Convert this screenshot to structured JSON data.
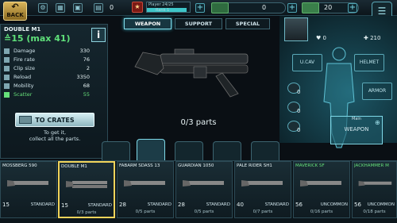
{
  "topbar": {
    "back_label": "BACK",
    "bolts_count": "0",
    "xp_label": "Player 24/25",
    "rank_label": "Rank 1",
    "cash_amount": "0",
    "gold_amount": "20"
  },
  "weapon": {
    "name": "DOUBLE M1",
    "level_text": "15 (max 41)",
    "stats": [
      {
        "label": "Damage",
        "value": "330"
      },
      {
        "label": "Fire rate",
        "value": "76"
      },
      {
        "label": "Clip size",
        "value": "2"
      },
      {
        "label": "Reload",
        "value": "3350"
      },
      {
        "label": "Mobility",
        "value": "68"
      },
      {
        "label": "Scatter",
        "value": "55"
      }
    ],
    "crates_label": "TO CRATES",
    "hint_line1": "To get it,",
    "hint_line2": "collect all the parts.",
    "parts_text": "0/3 parts"
  },
  "tabs": [
    {
      "label": "WEAPON"
    },
    {
      "label": "SUPPORT"
    },
    {
      "label": "SPECIAL"
    }
  ],
  "player": {
    "like_count": "0",
    "score": "210",
    "slots": {
      "ucav": "U.CAV",
      "helmet": "HELMET",
      "armor": "ARMOR"
    },
    "consumables": [
      {
        "count": "0"
      },
      {
        "count": "0"
      },
      {
        "count": "0"
      }
    ],
    "main_label": "Main",
    "main_weapon": "WEAPON"
  },
  "cards": [
    {
      "name": "MOSSBERG 590",
      "level": "15",
      "rarity": "STANDARD",
      "parts": ""
    },
    {
      "name": "DOUBLE M1",
      "level": "15",
      "rarity": "STANDARD",
      "parts": "0/3 parts"
    },
    {
      "name": "FABARM SDASS 13",
      "level": "28",
      "rarity": "STANDARD",
      "parts": "0/5 parts"
    },
    {
      "name": "GUARDIAN 1050",
      "level": "28",
      "rarity": "STANDARD",
      "parts": "0/5 parts"
    },
    {
      "name": "PALE RIDER SH1",
      "level": "40",
      "rarity": "STANDARD",
      "parts": "0/7 parts"
    },
    {
      "name": "MAVERICK SF",
      "level": "56",
      "rarity": "UNCOMMON",
      "parts": "0/16 parts"
    },
    {
      "name": "JACKHAMMER M",
      "level": "56",
      "rarity": "UNCOMMON",
      "parts": "0/18 parts"
    }
  ],
  "colors": {
    "accent": "#7fd9e8",
    "level": "#5fe07a",
    "selected": "#f0d35a"
  },
  "icons": [
    "back-arrow-icon",
    "crate-icon",
    "gear-icon",
    "heart-icon",
    "cross-icon"
  ]
}
